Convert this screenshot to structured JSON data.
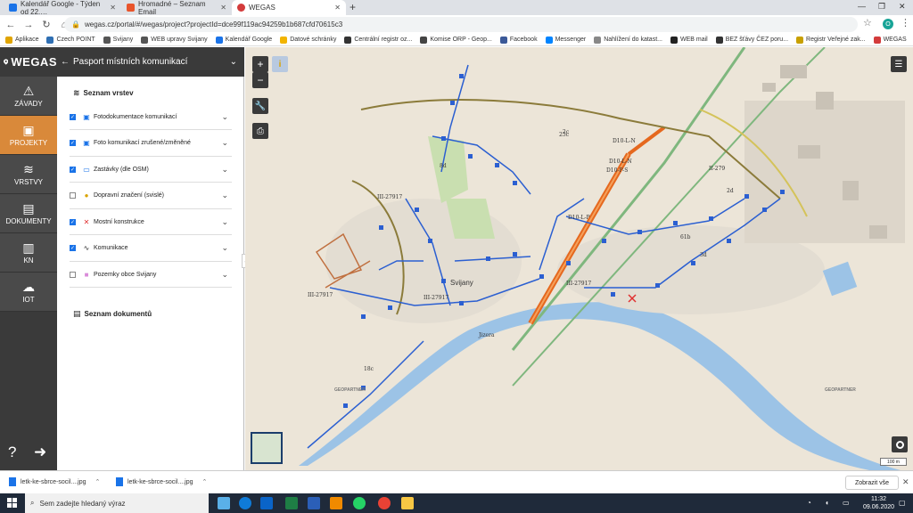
{
  "browser": {
    "tabs": [
      {
        "title": "Kalendář Google - Týden od 22.…",
        "favicon_color": "#1a73e8"
      },
      {
        "title": "Hromadné – Seznam Email",
        "favicon_color": "#e8542b"
      },
      {
        "title": "WEGAS",
        "favicon_color": "#d33b3b"
      }
    ],
    "new_tab": "+",
    "url": "wegas.cz/portal/#/wegas/project?projectId=dce99f119ac94259b1b687cfd70615c3",
    "profile_initial": "O",
    "bookmarks": [
      {
        "label": "Aplikace",
        "color": "#e0a400"
      },
      {
        "label": "Czech POINT",
        "color": "#2f6fb3"
      },
      {
        "label": "Svijany",
        "color": "#555555"
      },
      {
        "label": "WEB upravy Svijany",
        "color": "#555555"
      },
      {
        "label": "Kalendář Google",
        "color": "#1a73e8"
      },
      {
        "label": "Datové schránky",
        "color": "#f2b400"
      },
      {
        "label": "Centrální registr oz...",
        "color": "#333333"
      },
      {
        "label": "Komise ORP - Geop...",
        "color": "#444444"
      },
      {
        "label": "Facebook",
        "color": "#3b5998"
      },
      {
        "label": "Messenger",
        "color": "#0084ff"
      },
      {
        "label": "Nahlížení do katast...",
        "color": "#888888"
      },
      {
        "label": "WEB mail",
        "color": "#222222"
      },
      {
        "label": "BEZ šťávy ČEZ poru...",
        "color": "#333333"
      },
      {
        "label": "Registr Veřejné zak...",
        "color": "#c8a000"
      },
      {
        "label": "WEGAS",
        "color": "#d33b3b"
      }
    ]
  },
  "app": {
    "brand": "WEGAS",
    "rail": [
      {
        "label": "ZÁVADY",
        "icon": "warning-icon",
        "glyph": "⚠"
      },
      {
        "label": "PROJEKTY",
        "icon": "projects-icon",
        "glyph": "▣"
      },
      {
        "label": "VRSTVY",
        "icon": "layers-icon",
        "glyph": "≋"
      },
      {
        "label": "DOKUMENTY",
        "icon": "document-icon",
        "glyph": "▤"
      },
      {
        "label": "KN",
        "icon": "building-icon",
        "glyph": "▥"
      },
      {
        "label": "IOT",
        "icon": "cloud-icon",
        "glyph": "☁"
      }
    ],
    "rail_bottom": {
      "help": "?",
      "logout": "➜"
    },
    "panel_title": "Pasport místních komunikací",
    "layers_heading": "Seznam vrstev",
    "layers": [
      {
        "label": "Fotodokumentace komunikací",
        "checked": true,
        "icon_color": "#1a73e8",
        "glyph": "▣"
      },
      {
        "label": "Foto komunikací zrušené/změněné",
        "checked": true,
        "icon_color": "#1a73e8",
        "glyph": "▣"
      },
      {
        "label": "Zastávky (dle OSM)",
        "checked": true,
        "icon_color": "#1a73e8",
        "glyph": "▭"
      },
      {
        "label": "Dopravní značení (svislé)",
        "checked": false,
        "icon_color": "#d9a300",
        "glyph": "●"
      },
      {
        "label": "Mostní konstrukce",
        "checked": true,
        "icon_color": "#e03030",
        "glyph": "✕"
      },
      {
        "label": "Komunikace",
        "checked": true,
        "icon_color": "#333333",
        "glyph": "∿"
      },
      {
        "label": "Pozemky obce Svijany",
        "checked": false,
        "icon_color": "#d98bd9",
        "glyph": "■"
      }
    ],
    "documents_heading": "Seznam dokumentů"
  },
  "map": {
    "labels": [
      "Svijany",
      "III-27917",
      "III-27917",
      "III-27917",
      "III-27917",
      "D10-L-P",
      "D10-L-N",
      "D10-P-S",
      "D10-L-N",
      "II-279",
      "18c",
      "Jizera",
      "2d",
      "3d",
      "61b",
      "2c",
      "8d",
      "25c"
    ],
    "watermark": "GEOPARTNER",
    "scale": "100 m"
  },
  "downloads": {
    "items": [
      "letk-ke-sbrce-socil....jpg",
      "letk-ke-sbrce-socil....jpg"
    ],
    "show_all": "Zobrazit vše"
  },
  "taskbar": {
    "search_placeholder": "Sem zadejte hledaný výraz",
    "time": "11:32",
    "date": "09.06.2020"
  }
}
